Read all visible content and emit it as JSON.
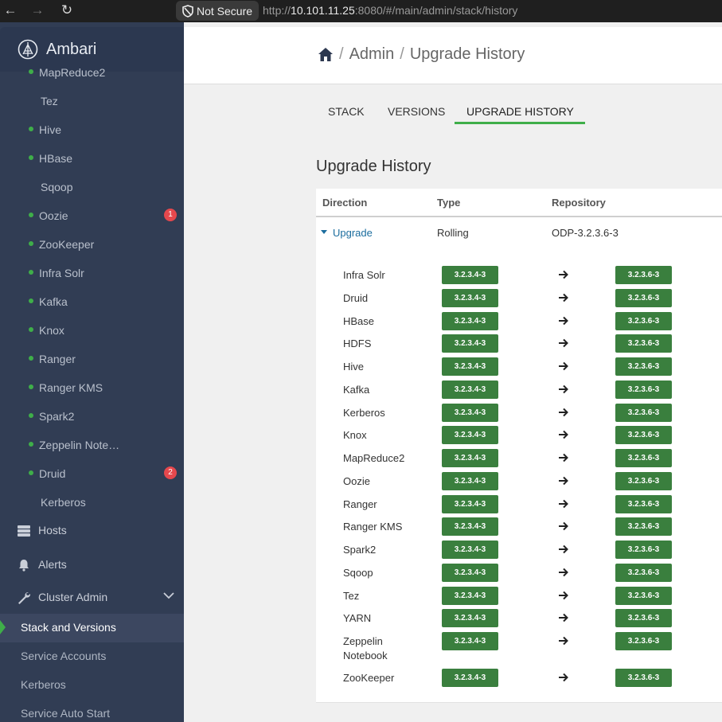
{
  "browser": {
    "security_label": "Not Secure",
    "url_scheme": "http://",
    "url_host": "10.101.11.25",
    "url_rest": ":8080/#/main/admin/stack/history"
  },
  "sidebar": {
    "brand": "Ambari",
    "services": [
      {
        "name": "MapReduce2",
        "dot": true,
        "badge": ""
      },
      {
        "name": "Tez",
        "dot": false,
        "badge": ""
      },
      {
        "name": "Hive",
        "dot": true,
        "badge": ""
      },
      {
        "name": "HBase",
        "dot": true,
        "badge": ""
      },
      {
        "name": "Sqoop",
        "dot": false,
        "badge": ""
      },
      {
        "name": "Oozie",
        "dot": true,
        "badge": "1"
      },
      {
        "name": "ZooKeeper",
        "dot": true,
        "badge": ""
      },
      {
        "name": "Infra Solr",
        "dot": true,
        "badge": ""
      },
      {
        "name": "Kafka",
        "dot": true,
        "badge": ""
      },
      {
        "name": "Knox",
        "dot": true,
        "badge": ""
      },
      {
        "name": "Ranger",
        "dot": true,
        "badge": ""
      },
      {
        "name": "Ranger KMS",
        "dot": true,
        "badge": ""
      },
      {
        "name": "Spark2",
        "dot": true,
        "badge": ""
      },
      {
        "name": "Zeppelin Note…",
        "dot": true,
        "badge": ""
      },
      {
        "name": "Druid",
        "dot": true,
        "badge": "2"
      },
      {
        "name": "Kerberos",
        "dot": false,
        "badge": ""
      }
    ],
    "hosts": "Hosts",
    "alerts": "Alerts",
    "cluster_admin": "Cluster Admin",
    "cluster_admin_items": [
      "Stack and Versions",
      "Service Accounts",
      "Kerberos",
      "Service Auto Start"
    ]
  },
  "breadcrumb": {
    "admin": "Admin",
    "current": "Upgrade History",
    "separator": "/"
  },
  "tabs": [
    "STACK",
    "VERSIONS",
    "UPGRADE HISTORY"
  ],
  "section_title": "Upgrade History",
  "table": {
    "headers": [
      "Direction",
      "Type",
      "Repository"
    ],
    "summary": {
      "direction": "Upgrade",
      "type": "Rolling",
      "repository": "ODP-3.2.3.6-3"
    },
    "components": [
      {
        "name": "Infra Solr",
        "from": "3.2.3.4-3",
        "to": "3.2.3.6-3"
      },
      {
        "name": "Druid",
        "from": "3.2.3.4-3",
        "to": "3.2.3.6-3"
      },
      {
        "name": "HBase",
        "from": "3.2.3.4-3",
        "to": "3.2.3.6-3"
      },
      {
        "name": "HDFS",
        "from": "3.2.3.4-3",
        "to": "3.2.3.6-3"
      },
      {
        "name": "Hive",
        "from": "3.2.3.4-3",
        "to": "3.2.3.6-3"
      },
      {
        "name": "Kafka",
        "from": "3.2.3.4-3",
        "to": "3.2.3.6-3"
      },
      {
        "name": "Kerberos",
        "from": "3.2.3.4-3",
        "to": "3.2.3.6-3"
      },
      {
        "name": "Knox",
        "from": "3.2.3.4-3",
        "to": "3.2.3.6-3"
      },
      {
        "name": "MapReduce2",
        "from": "3.2.3.4-3",
        "to": "3.2.3.6-3"
      },
      {
        "name": "Oozie",
        "from": "3.2.3.4-3",
        "to": "3.2.3.6-3"
      },
      {
        "name": "Ranger",
        "from": "3.2.3.4-3",
        "to": "3.2.3.6-3"
      },
      {
        "name": "Ranger KMS",
        "from": "3.2.3.4-3",
        "to": "3.2.3.6-3"
      },
      {
        "name": "Spark2",
        "from": "3.2.3.4-3",
        "to": "3.2.3.6-3"
      },
      {
        "name": "Sqoop",
        "from": "3.2.3.4-3",
        "to": "3.2.3.6-3"
      },
      {
        "name": "Tez",
        "from": "3.2.3.4-3",
        "to": "3.2.3.6-3"
      },
      {
        "name": "YARN",
        "from": "3.2.3.4-3",
        "to": "3.2.3.6-3"
      },
      {
        "name": "Zeppelin Notebook",
        "from": "3.2.3.4-3",
        "to": "3.2.3.6-3"
      },
      {
        "name": "ZooKeeper",
        "from": "3.2.3.4-3",
        "to": "3.2.3.6-3"
      }
    ]
  },
  "colors": {
    "sidebar_bg": "#313d54",
    "status_green": "#3fae49",
    "version_badge": "#3a7f3e",
    "link_blue": "#1b6d9e",
    "alert_red": "#e5484d"
  }
}
